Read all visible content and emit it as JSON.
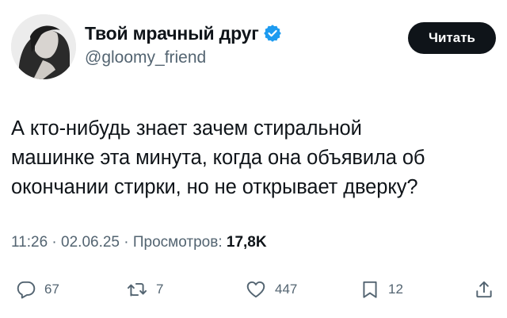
{
  "author": {
    "display_name": "Твой мрачный друг",
    "handle": "@gloomy_friend",
    "verified": true
  },
  "follow_button_label": "Читать",
  "tweet": {
    "lines": [
      "А кто-нибудь знает зачем стиральной",
      "машинке эта минута, когда она объявила об",
      "окончании стирки, но не открывает дверку?"
    ]
  },
  "meta": {
    "time": "11:26",
    "date": "02.06.25",
    "separator": " · ",
    "views_label": "Просмотров:",
    "views_count": "17,8K"
  },
  "actions": {
    "replies": "67",
    "reposts": "7",
    "likes": "447",
    "bookmarks": "12"
  },
  "colors": {
    "text": "#0f1419",
    "secondary": "#536471",
    "verified": "#1d9bf0",
    "button": "#0f1419"
  },
  "icons": {
    "reply": "reply-icon",
    "repost": "repost-icon",
    "like": "heart-icon",
    "bookmark": "bookmark-icon",
    "share": "share-icon",
    "verified": "verified-badge-icon"
  }
}
